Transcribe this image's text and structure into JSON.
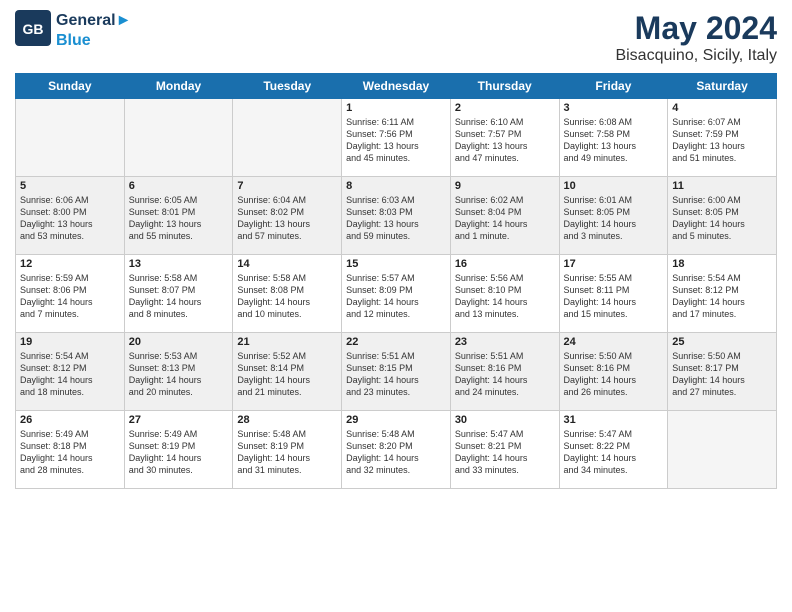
{
  "logo": {
    "line1": "General",
    "line2": "Blue"
  },
  "title": "May 2024",
  "location": "Bisacquino, Sicily, Italy",
  "weekdays": [
    "Sunday",
    "Monday",
    "Tuesday",
    "Wednesday",
    "Thursday",
    "Friday",
    "Saturday"
  ],
  "weeks": [
    [
      {
        "day": "",
        "text": ""
      },
      {
        "day": "",
        "text": ""
      },
      {
        "day": "",
        "text": ""
      },
      {
        "day": "1",
        "text": "Sunrise: 6:11 AM\nSunset: 7:56 PM\nDaylight: 13 hours\nand 45 minutes."
      },
      {
        "day": "2",
        "text": "Sunrise: 6:10 AM\nSunset: 7:57 PM\nDaylight: 13 hours\nand 47 minutes."
      },
      {
        "day": "3",
        "text": "Sunrise: 6:08 AM\nSunset: 7:58 PM\nDaylight: 13 hours\nand 49 minutes."
      },
      {
        "day": "4",
        "text": "Sunrise: 6:07 AM\nSunset: 7:59 PM\nDaylight: 13 hours\nand 51 minutes."
      }
    ],
    [
      {
        "day": "5",
        "text": "Sunrise: 6:06 AM\nSunset: 8:00 PM\nDaylight: 13 hours\nand 53 minutes."
      },
      {
        "day": "6",
        "text": "Sunrise: 6:05 AM\nSunset: 8:01 PM\nDaylight: 13 hours\nand 55 minutes."
      },
      {
        "day": "7",
        "text": "Sunrise: 6:04 AM\nSunset: 8:02 PM\nDaylight: 13 hours\nand 57 minutes."
      },
      {
        "day": "8",
        "text": "Sunrise: 6:03 AM\nSunset: 8:03 PM\nDaylight: 13 hours\nand 59 minutes."
      },
      {
        "day": "9",
        "text": "Sunrise: 6:02 AM\nSunset: 8:04 PM\nDaylight: 14 hours\nand 1 minute."
      },
      {
        "day": "10",
        "text": "Sunrise: 6:01 AM\nSunset: 8:05 PM\nDaylight: 14 hours\nand 3 minutes."
      },
      {
        "day": "11",
        "text": "Sunrise: 6:00 AM\nSunset: 8:05 PM\nDaylight: 14 hours\nand 5 minutes."
      }
    ],
    [
      {
        "day": "12",
        "text": "Sunrise: 5:59 AM\nSunset: 8:06 PM\nDaylight: 14 hours\nand 7 minutes."
      },
      {
        "day": "13",
        "text": "Sunrise: 5:58 AM\nSunset: 8:07 PM\nDaylight: 14 hours\nand 8 minutes."
      },
      {
        "day": "14",
        "text": "Sunrise: 5:58 AM\nSunset: 8:08 PM\nDaylight: 14 hours\nand 10 minutes."
      },
      {
        "day": "15",
        "text": "Sunrise: 5:57 AM\nSunset: 8:09 PM\nDaylight: 14 hours\nand 12 minutes."
      },
      {
        "day": "16",
        "text": "Sunrise: 5:56 AM\nSunset: 8:10 PM\nDaylight: 14 hours\nand 13 minutes."
      },
      {
        "day": "17",
        "text": "Sunrise: 5:55 AM\nSunset: 8:11 PM\nDaylight: 14 hours\nand 15 minutes."
      },
      {
        "day": "18",
        "text": "Sunrise: 5:54 AM\nSunset: 8:12 PM\nDaylight: 14 hours\nand 17 minutes."
      }
    ],
    [
      {
        "day": "19",
        "text": "Sunrise: 5:54 AM\nSunset: 8:12 PM\nDaylight: 14 hours\nand 18 minutes."
      },
      {
        "day": "20",
        "text": "Sunrise: 5:53 AM\nSunset: 8:13 PM\nDaylight: 14 hours\nand 20 minutes."
      },
      {
        "day": "21",
        "text": "Sunrise: 5:52 AM\nSunset: 8:14 PM\nDaylight: 14 hours\nand 21 minutes."
      },
      {
        "day": "22",
        "text": "Sunrise: 5:51 AM\nSunset: 8:15 PM\nDaylight: 14 hours\nand 23 minutes."
      },
      {
        "day": "23",
        "text": "Sunrise: 5:51 AM\nSunset: 8:16 PM\nDaylight: 14 hours\nand 24 minutes."
      },
      {
        "day": "24",
        "text": "Sunrise: 5:50 AM\nSunset: 8:16 PM\nDaylight: 14 hours\nand 26 minutes."
      },
      {
        "day": "25",
        "text": "Sunrise: 5:50 AM\nSunset: 8:17 PM\nDaylight: 14 hours\nand 27 minutes."
      }
    ],
    [
      {
        "day": "26",
        "text": "Sunrise: 5:49 AM\nSunset: 8:18 PM\nDaylight: 14 hours\nand 28 minutes."
      },
      {
        "day": "27",
        "text": "Sunrise: 5:49 AM\nSunset: 8:19 PM\nDaylight: 14 hours\nand 30 minutes."
      },
      {
        "day": "28",
        "text": "Sunrise: 5:48 AM\nSunset: 8:19 PM\nDaylight: 14 hours\nand 31 minutes."
      },
      {
        "day": "29",
        "text": "Sunrise: 5:48 AM\nSunset: 8:20 PM\nDaylight: 14 hours\nand 32 minutes."
      },
      {
        "day": "30",
        "text": "Sunrise: 5:47 AM\nSunset: 8:21 PM\nDaylight: 14 hours\nand 33 minutes."
      },
      {
        "day": "31",
        "text": "Sunrise: 5:47 AM\nSunset: 8:22 PM\nDaylight: 14 hours\nand 34 minutes."
      },
      {
        "day": "",
        "text": ""
      }
    ]
  ]
}
